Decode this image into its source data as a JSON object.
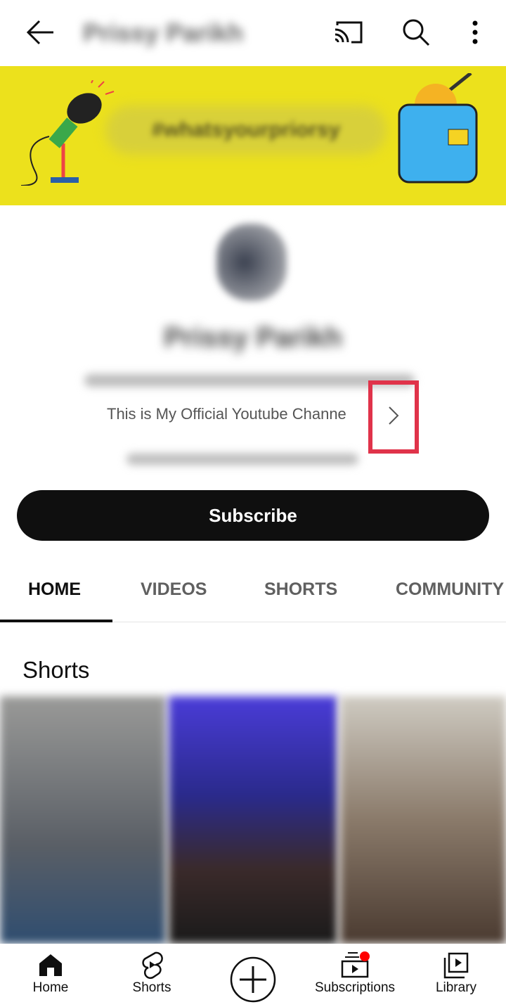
{
  "header": {
    "channel_title": "Prissy Parikh",
    "icons": [
      "back-arrow-icon",
      "cast-icon",
      "search-icon",
      "more-vert-icon"
    ]
  },
  "banner": {
    "tagline": "#whatsyourpriorsy",
    "colors": {
      "background": "#ece11c"
    }
  },
  "channel": {
    "name": "Prissy Parikh",
    "description": "This is My Official Youtube Channe",
    "subscribe_label": "Subscribe"
  },
  "tabs": [
    {
      "label": "HOME",
      "active": true
    },
    {
      "label": "VIDEOS"
    },
    {
      "label": "SHORTS"
    },
    {
      "label": "COMMUNITY"
    }
  ],
  "section": {
    "title": "Shorts"
  },
  "bottom_nav": [
    {
      "label": "Home",
      "icon": "home-icon"
    },
    {
      "label": "Shorts",
      "icon": "shorts-icon"
    },
    {
      "label": "",
      "icon": "create-plus-icon"
    },
    {
      "label": "Subscriptions",
      "icon": "subscriptions-icon",
      "badge": true
    },
    {
      "label": "Library",
      "icon": "library-icon"
    }
  ],
  "colors": {
    "highlight": "#e0334a",
    "badge": "#ff0000"
  }
}
